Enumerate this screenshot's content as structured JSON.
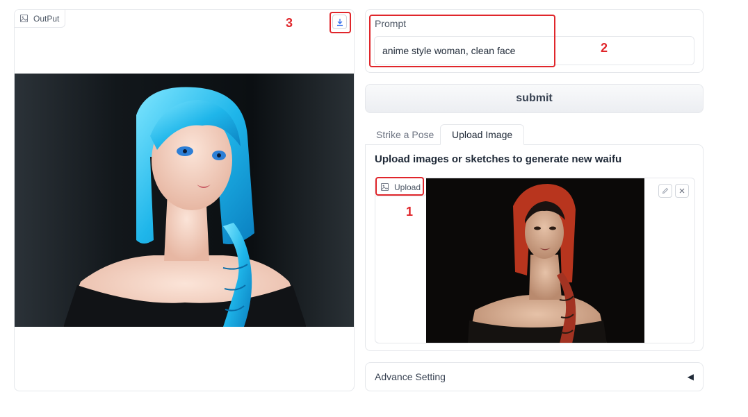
{
  "output": {
    "label": "OutPut",
    "image_icon": "image-icon",
    "download_icon": "download-icon"
  },
  "prompt": {
    "label": "Prompt",
    "value": "anime style woman, clean face"
  },
  "submit": {
    "label": "submit"
  },
  "tabs": [
    {
      "label": "Strike a Pose",
      "selected": false
    },
    {
      "label": "Upload Image",
      "selected": true
    }
  ],
  "upload": {
    "heading": "Upload images or sketches to generate new waifu",
    "label": "Upload",
    "edit_icon": "pencil-icon",
    "clear_icon": "close-icon"
  },
  "accordion": {
    "label": "Advance Setting",
    "arrow": "◀"
  },
  "annotations": [
    "1",
    "2",
    "3"
  ],
  "colors": {
    "annotation": "#e0262b",
    "download_accent": "#2563eb"
  }
}
